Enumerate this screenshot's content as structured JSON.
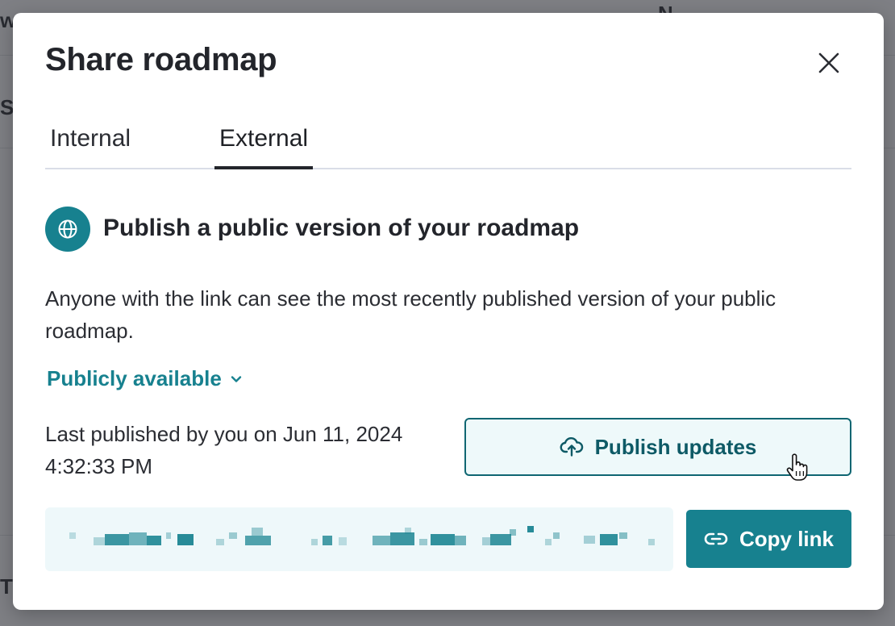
{
  "modal": {
    "title": "Share roadmap",
    "tabs": [
      {
        "label": "Internal",
        "active": false
      },
      {
        "label": "External",
        "active": true
      }
    ],
    "section": {
      "icon": "globe-icon",
      "heading": "Publish a public version of your roadmap",
      "description": "Anyone with the link can see the most recently published version of your public roadmap."
    },
    "visibility": {
      "selected": "Publicly available",
      "icon": "chevron-down-icon"
    },
    "last_published": {
      "line1": "Last published by you on Jun 11, 2024",
      "line2": "4:32:33 PM"
    },
    "publish_button": {
      "label": "Publish updates",
      "icon": "cloud-upload-icon"
    },
    "share_link": {
      "redacted": true
    },
    "copy_button": {
      "label": "Copy link",
      "icon": "link-icon"
    }
  },
  "colors": {
    "accent": "#17818f",
    "accent_dark": "#0e5a66",
    "publish_bg": "#eef9fa",
    "link_field_bg": "#eef8fa",
    "text": "#23252b"
  }
}
